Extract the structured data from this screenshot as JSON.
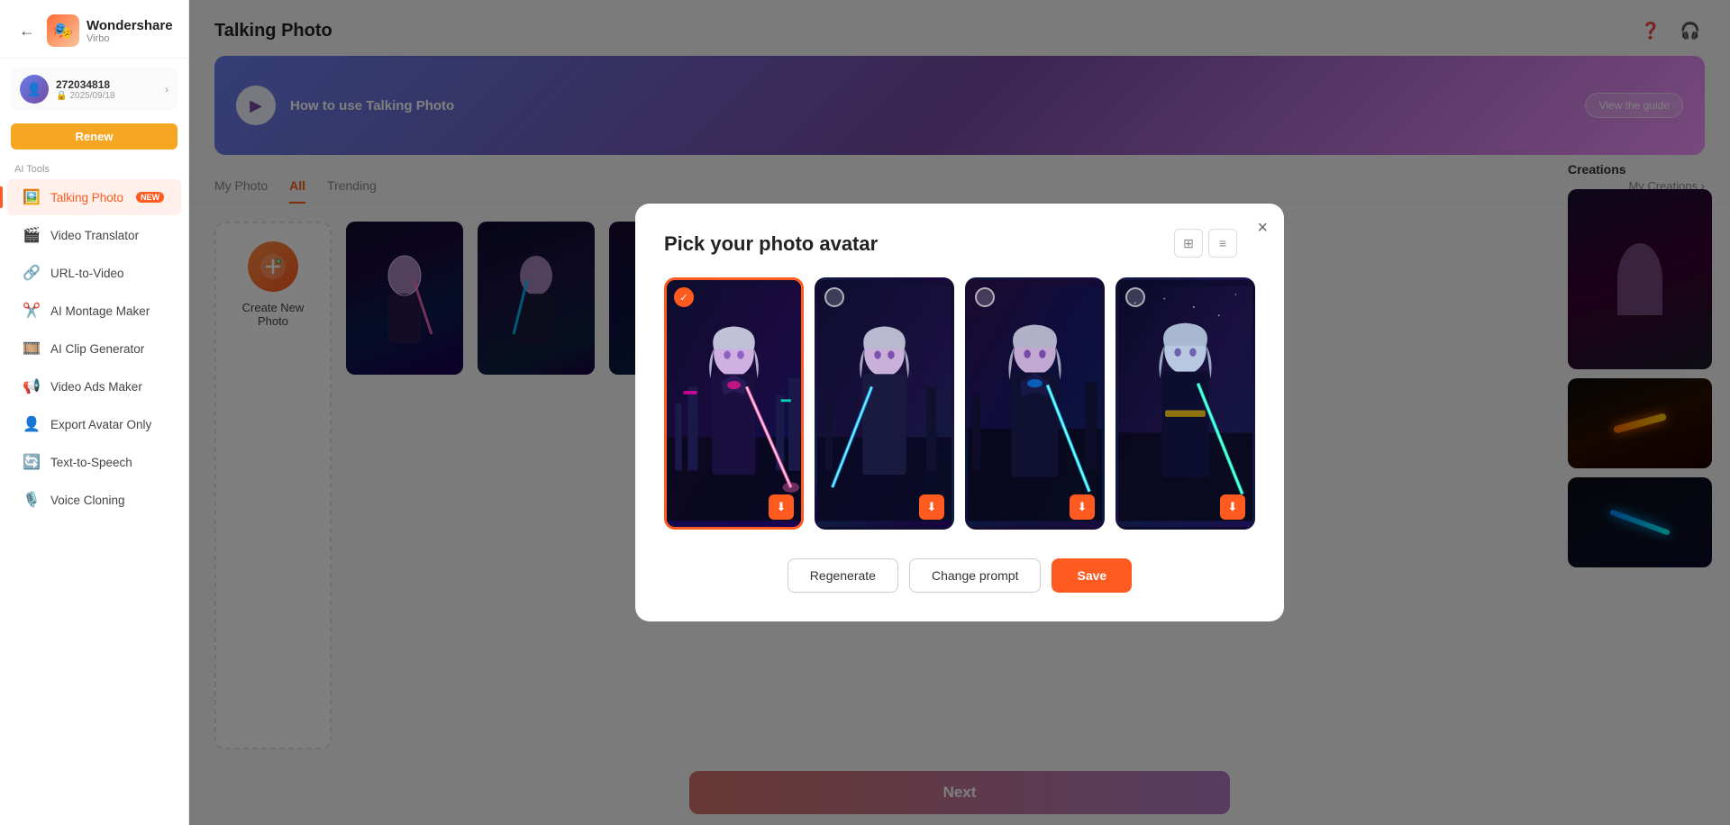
{
  "app": {
    "title": "Talking Photo",
    "logo_text": "Virbo",
    "logo_brand": "Wondershare"
  },
  "user": {
    "id": "272034818",
    "date": "2025/09/18",
    "renew_label": "Renew"
  },
  "sidebar": {
    "ai_tools_label": "AI Tools",
    "items": [
      {
        "id": "talking-photo",
        "label": "Talking Photo",
        "active": true,
        "badge": "NEW"
      },
      {
        "id": "video-translator",
        "label": "Video Translator",
        "active": false
      },
      {
        "id": "url-to-video",
        "label": "URL-to-Video",
        "active": false
      },
      {
        "id": "ai-montage-maker",
        "label": "AI Montage Maker",
        "active": false
      },
      {
        "id": "ai-clip-generator",
        "label": "AI Clip Generator",
        "active": false
      },
      {
        "id": "video-ads-maker",
        "label": "Video Ads Maker",
        "active": false
      },
      {
        "id": "export-avatar-only",
        "label": "Export Avatar Only",
        "active": false
      },
      {
        "id": "text-to-speech",
        "label": "Text-to-Speech",
        "active": false
      },
      {
        "id": "voice-cloning",
        "label": "Voice Cloning",
        "active": false
      }
    ]
  },
  "banner": {
    "title": "How to use Talking Photo",
    "button_label": "View the guide"
  },
  "tabs": {
    "items": [
      {
        "id": "my-photo",
        "label": "My Photo"
      },
      {
        "id": "all",
        "label": "All",
        "active": true
      },
      {
        "id": "trending",
        "label": "Trending"
      }
    ],
    "my_creations_label": "My Creations ›"
  },
  "create_new": {
    "label": "Create New Photo"
  },
  "next_button": {
    "label": "Next"
  },
  "modal": {
    "title": "Pick your photo avatar",
    "close_label": "×",
    "images": [
      {
        "id": "img-1",
        "selected": true
      },
      {
        "id": "img-2",
        "selected": false
      },
      {
        "id": "img-3",
        "selected": false
      },
      {
        "id": "img-4",
        "selected": false
      }
    ],
    "buttons": {
      "regenerate": "Regenerate",
      "change_prompt": "Change prompt",
      "save": "Save"
    }
  },
  "creations": {
    "title": "Creations"
  }
}
